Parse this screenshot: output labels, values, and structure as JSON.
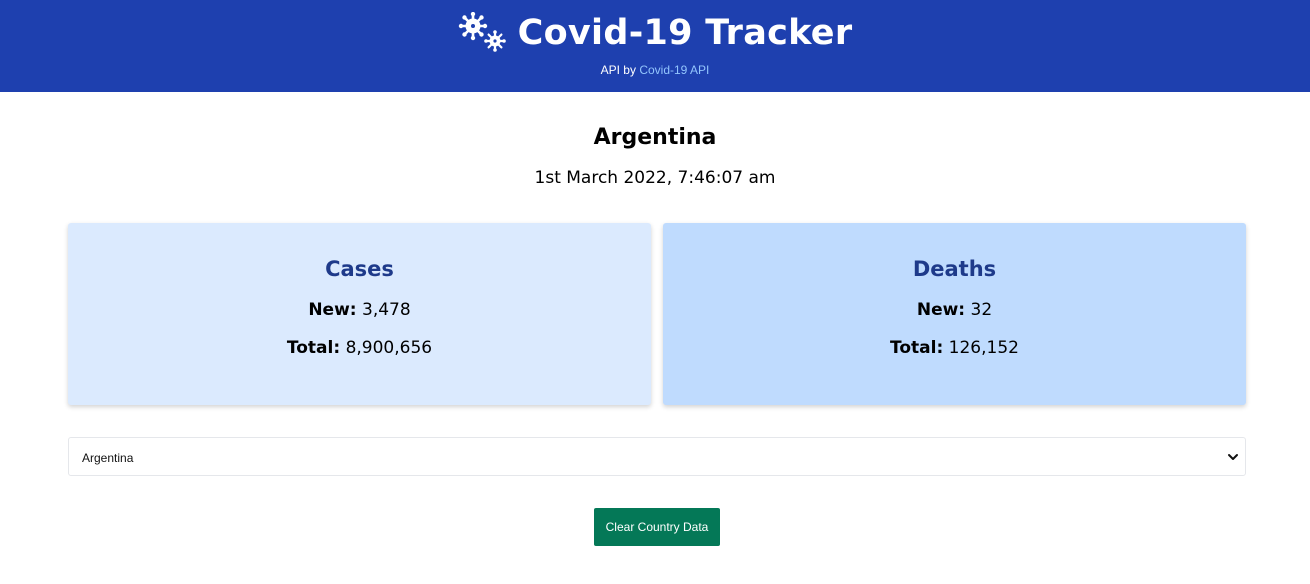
{
  "header": {
    "title": "Covid-19 Tracker",
    "icon": "virus-icon",
    "api_prefix": "API by",
    "api_link_label": "Covid-19 API",
    "background_color": "#1e40af",
    "link_color": "#93c5fd"
  },
  "country": {
    "name": "Argentina",
    "updated": "1st March 2022, 7:46:07 am"
  },
  "cards": {
    "cases": {
      "title": "Cases",
      "new_label": "New:",
      "new_value": "3,478",
      "total_label": "Total:",
      "total_value": "8,900,656",
      "background_color": "#dbeafe"
    },
    "deaths": {
      "title": "Deaths",
      "new_label": "New:",
      "new_value": "32",
      "total_label": "Total:",
      "total_value": "126,152",
      "background_color": "#bfdbfe"
    }
  },
  "country_select": {
    "selected": "Argentina",
    "icon": "chevron-down-icon"
  },
  "clear_button": {
    "label": "Clear Country Data",
    "color": "#047857"
  }
}
